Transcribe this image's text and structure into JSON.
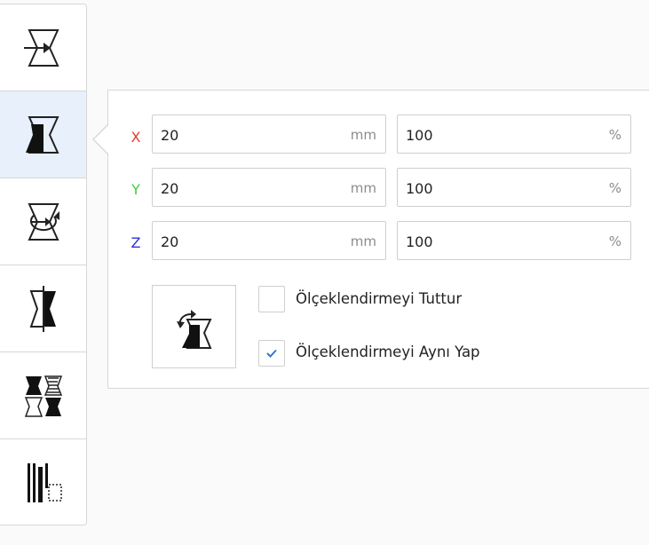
{
  "toolbar": {
    "tools": [
      {
        "name": "move-tool",
        "icon": "move-icon"
      },
      {
        "name": "scale-tool",
        "icon": "scale-icon",
        "active": true
      },
      {
        "name": "rotate-tool",
        "icon": "rotate-icon"
      },
      {
        "name": "mirror-tool",
        "icon": "mirror-icon"
      },
      {
        "name": "per-model-settings-tool",
        "icon": "per-model-settings-icon"
      },
      {
        "name": "support-blocker-tool",
        "icon": "support-blocker-icon"
      }
    ]
  },
  "scale_panel": {
    "axes": [
      {
        "label": "X",
        "color": "#e3402e",
        "size": "20",
        "size_unit": "mm",
        "percent": "100",
        "percent_unit": "%"
      },
      {
        "label": "Y",
        "color": "#3fd13f",
        "size": "20",
        "size_unit": "mm",
        "percent": "100",
        "percent_unit": "%"
      },
      {
        "label": "Z",
        "color": "#2f2fd6",
        "size": "20",
        "size_unit": "mm",
        "percent": "100",
        "percent_unit": "%"
      }
    ],
    "lock_button_icon": "reset-scale-icon",
    "options": [
      {
        "label": "Ölçeklendirmeyi Tuttur",
        "checked": false
      },
      {
        "label": "Ölçeklendirmeyi Aynı Yap",
        "checked": true
      }
    ],
    "check_color": "#2e7ad1"
  }
}
